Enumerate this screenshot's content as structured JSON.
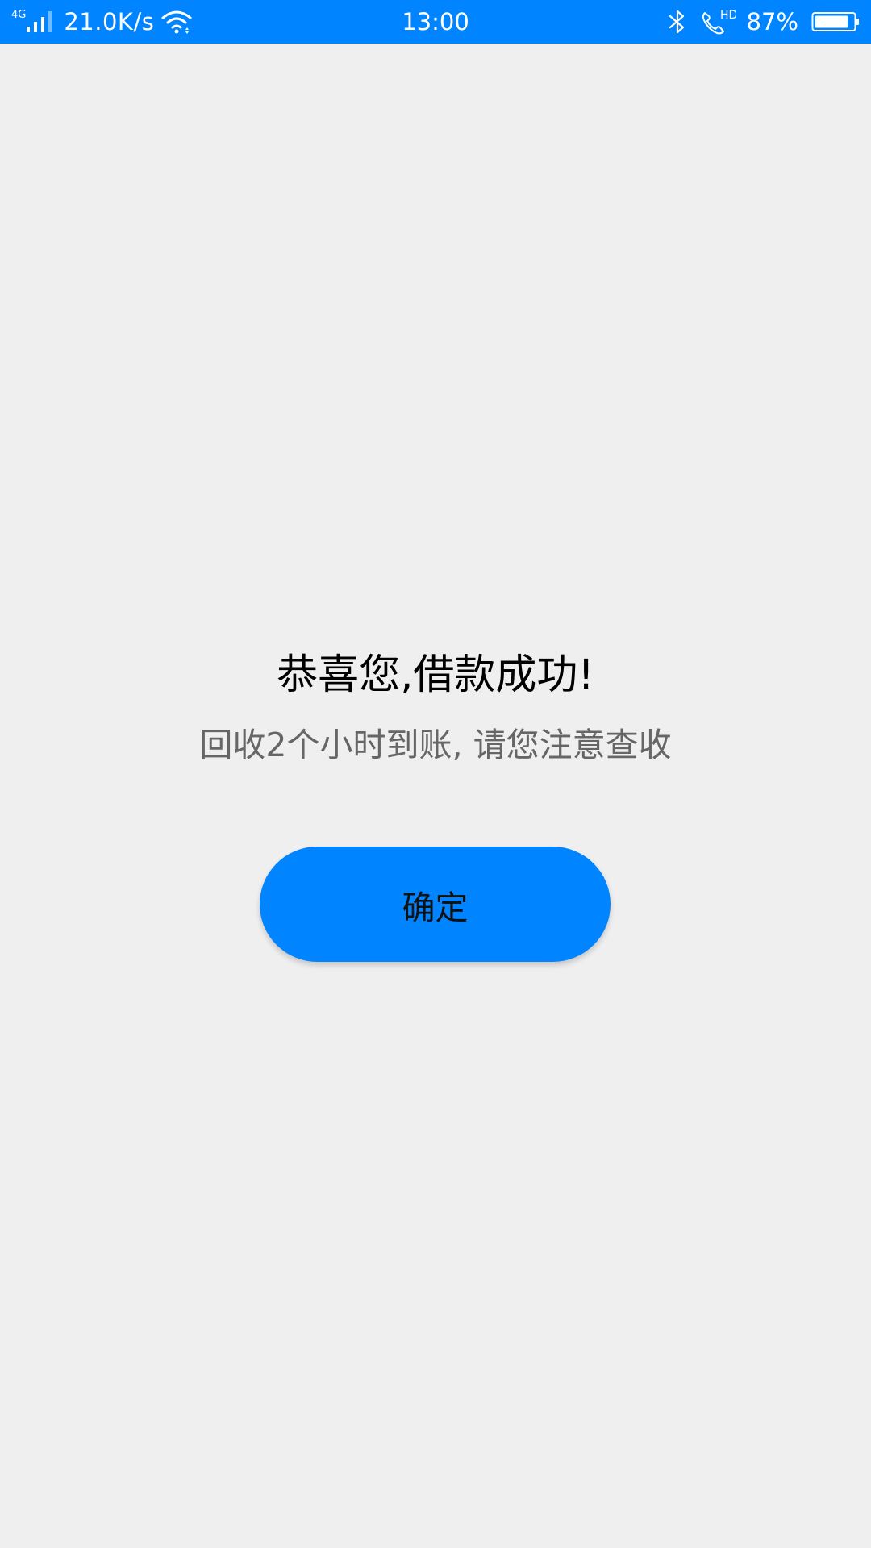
{
  "status_bar": {
    "network": "4G",
    "speed": "21.0K/s",
    "time": "13:00",
    "call_badge": "HD",
    "battery_percent": "87%",
    "battery_level": 0.87,
    "background_color": "#0084ff"
  },
  "main": {
    "title": "恭喜您,借款成功!",
    "subtitle": "回收2个小时到账, 请您注意查收",
    "confirm_label": "确定"
  },
  "colors": {
    "accent": "#0084ff",
    "page_background": "#efeff0",
    "title_text": "#000000",
    "subtitle_text": "#666666"
  }
}
